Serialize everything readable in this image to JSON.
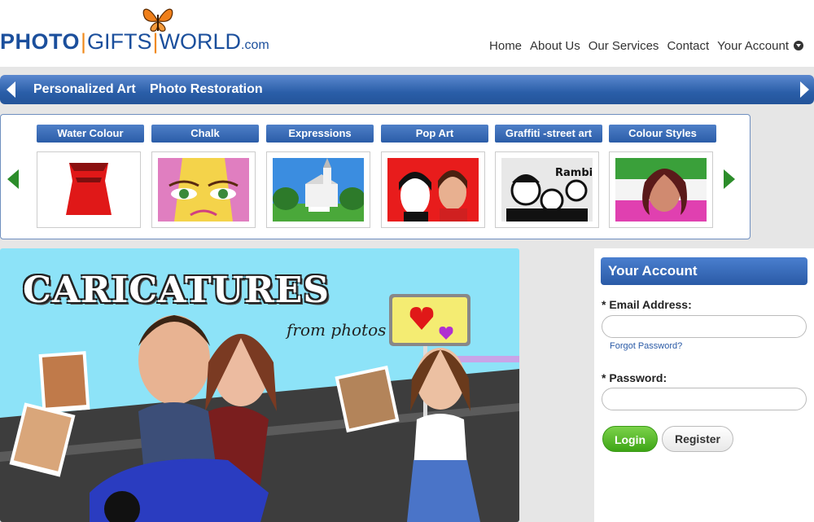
{
  "logo": {
    "part1": "PHOTO",
    "sep": "|",
    "part2": "GIFTS",
    "part3": "WORLD",
    "suffix": ".com"
  },
  "top_nav": [
    "Home",
    "About Us",
    "Our Services",
    "Contact",
    "Your Account"
  ],
  "category_bar": {
    "items": [
      "Personalized Art",
      "Photo Restoration"
    ]
  },
  "styles": {
    "tabs": [
      "Water Colour",
      "Chalk",
      "Expressions",
      "Pop Art",
      "Graffiti -street art",
      "Colour Styles"
    ],
    "graffiti_text": "Rambie"
  },
  "banner": {
    "title": "CARICATURES",
    "subtitle": "from photos"
  },
  "account": {
    "heading": "Your Account",
    "email_label": "* Email Address:",
    "forgot": "Forgot Password?",
    "password_label": "* Password:",
    "login": "Login",
    "register": "Register"
  },
  "colors": {
    "brand_blue": "#2a5ea8",
    "accent_orange": "#f08a1c",
    "login_green": "#3ea516"
  }
}
